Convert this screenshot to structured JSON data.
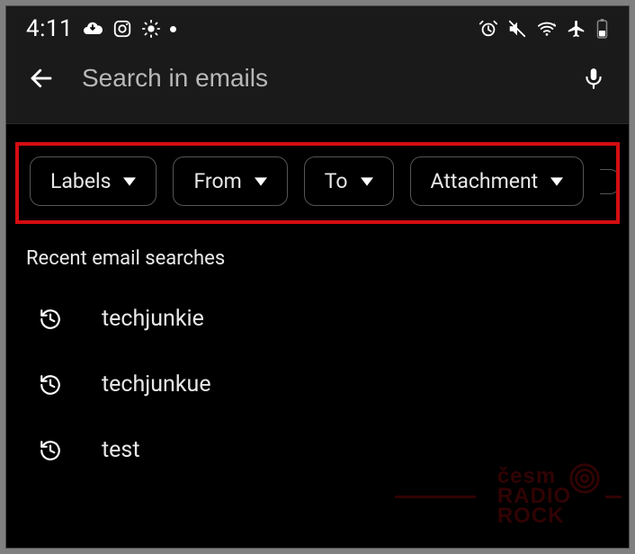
{
  "status_bar": {
    "time": "4:11",
    "left_icons": [
      "cloud-download-icon",
      "instagram-icon",
      "sun-icon",
      "dot-icon"
    ],
    "right_icons": [
      "alarm-icon",
      "mute-icon",
      "wifi-icon",
      "airplane-icon",
      "battery-icon"
    ]
  },
  "search_header": {
    "placeholder": "Search in emails"
  },
  "filter_chips": [
    {
      "label": "Labels"
    },
    {
      "label": "From"
    },
    {
      "label": "To"
    },
    {
      "label": "Attachment"
    }
  ],
  "recent": {
    "heading": "Recent email searches",
    "items": [
      "techjunkie",
      "techjunkue",
      "test"
    ]
  },
  "watermark": {
    "line1": "česm",
    "line2": "RADIO",
    "line3": "ROCK"
  }
}
